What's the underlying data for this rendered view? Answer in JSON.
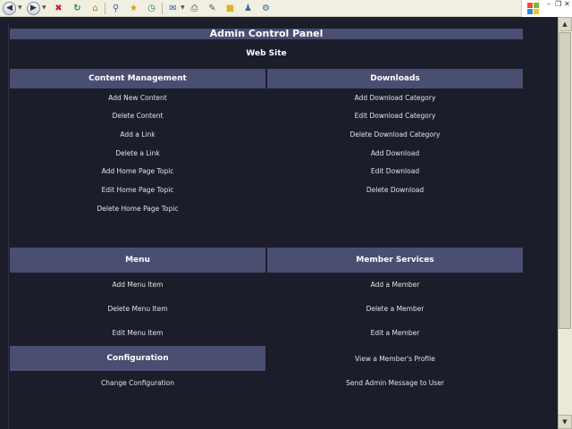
{
  "panel": {
    "title": "Admin Control Panel",
    "subtitle": "Web Site"
  },
  "sections": {
    "content_management": {
      "heading": "Content Management",
      "links": [
        "Add New Content",
        "Delete Content",
        "Add a Link",
        "Delete a Link",
        "Add Home Page Topic",
        "Edit Home Page Topic",
        "Delete Home Page Topic"
      ]
    },
    "downloads": {
      "heading": "Downloads",
      "links": [
        "Add Download Category",
        "Edit Download Category",
        "Delete Download Category",
        "Add Download",
        "Edit Download",
        "Delete Download"
      ]
    },
    "menu": {
      "heading": "Menu",
      "links": [
        "Add Menu Item",
        "Delete Menu Item",
        "Edit Menu Item"
      ]
    },
    "member_services": {
      "heading": "Member Services",
      "links": [
        "Add a Member",
        "Delete a Member",
        "Edit a Member",
        "View a Member's Profile",
        "Send Admin Message to User"
      ]
    },
    "configuration": {
      "heading": "Configuration",
      "links": [
        "Change Configuration"
      ]
    }
  },
  "colors": {
    "page_background": "#1b1d2a",
    "header_background": "#4a4e71",
    "text": "#ffffff",
    "toolbar": "#f1efe2"
  },
  "toolbar_icons": [
    "back-icon",
    "forward-icon",
    "stop-icon",
    "refresh-icon",
    "home-icon",
    "search-icon",
    "favorites-icon",
    "history-icon",
    "mail-icon",
    "print-icon",
    "edit-icon",
    "discuss-icon",
    "messenger-icon",
    "research-icon"
  ]
}
